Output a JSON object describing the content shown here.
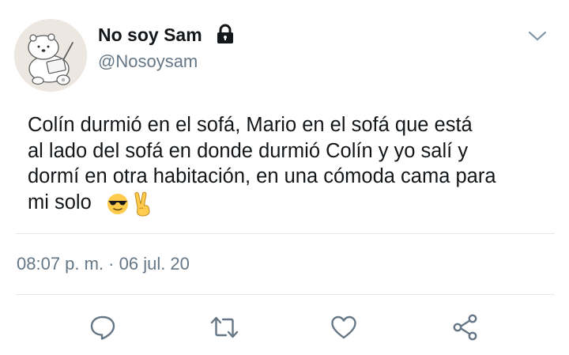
{
  "user": {
    "display_name": "No soy Sam",
    "handle": "@Nosoysam",
    "protected_icon": "lock-icon",
    "avatar": "polar-bear-drawing-avatar"
  },
  "tweet": {
    "text": "Colín durmió en el sofá, Mario en el sofá que está\nal lado del sofá en donde durmió Colín y yo salí y\ndormí en otra habitación, en una cómoda cama para\nmi solo",
    "emojis": [
      "sunglasses-emoji",
      "victory-hand-emoji"
    ],
    "timestamp": "08:07 p. m. · 06 jul. 20"
  },
  "menu": {
    "icon": "chevron-down-icon"
  },
  "actions": [
    {
      "name": "reply",
      "icon": "comment-icon"
    },
    {
      "name": "retweet",
      "icon": "retweet-icon"
    },
    {
      "name": "like",
      "icon": "heart-icon"
    },
    {
      "name": "share",
      "icon": "share-icon"
    }
  ],
  "colors": {
    "text": "#14171a",
    "secondary": "#657786",
    "divider": "#e1e8ed",
    "icon": "#657786"
  }
}
